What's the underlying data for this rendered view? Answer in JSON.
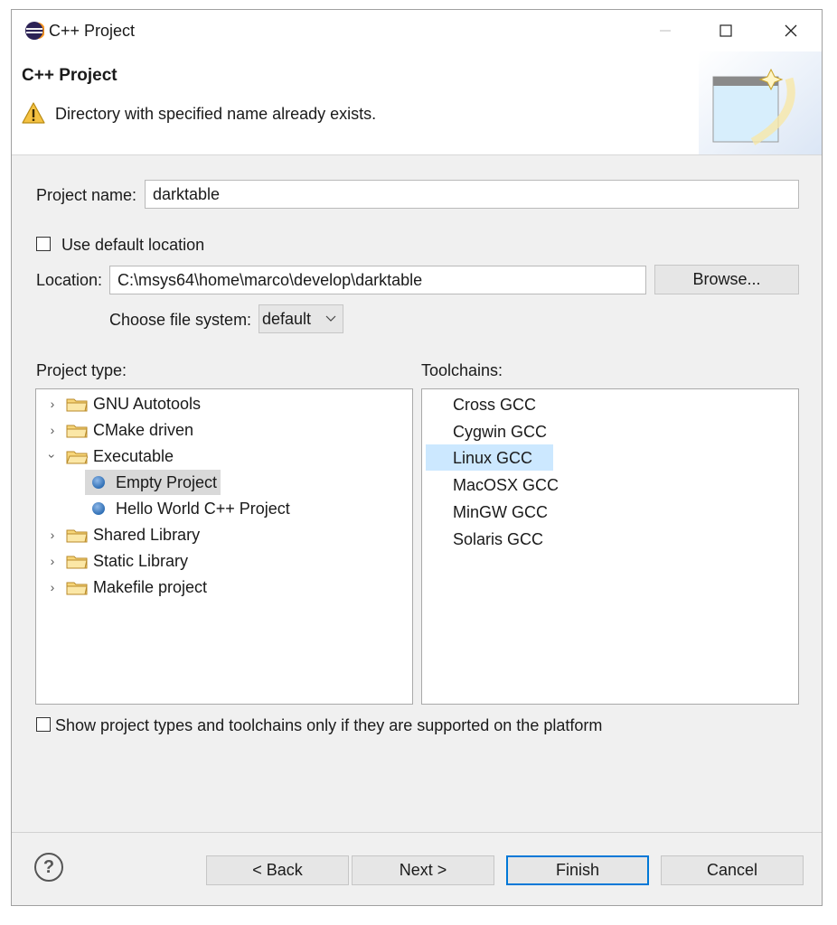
{
  "window": {
    "title": "C++ Project"
  },
  "banner": {
    "title": "C++ Project",
    "message": "Directory with specified name already exists."
  },
  "form": {
    "project_name_label": "Project name:",
    "project_name_value": "darktable",
    "use_default_location_label": "Use default location",
    "location_label": "Location:",
    "location_value": "C:\\msys64\\home\\marco\\develop\\darktable",
    "browse_label": "Browse...",
    "file_system_label": "Choose file system:",
    "file_system_value": "default"
  },
  "project_type": {
    "label": "Project type:",
    "items": [
      {
        "label": "GNU Autotools"
      },
      {
        "label": "CMake driven"
      },
      {
        "label": "Executable"
      },
      {
        "label": "Empty Project"
      },
      {
        "label": "Hello World C++ Project"
      },
      {
        "label": "Shared Library"
      },
      {
        "label": "Static Library"
      },
      {
        "label": "Makefile project"
      }
    ]
  },
  "toolchains": {
    "label": "Toolchains:",
    "items": [
      {
        "label": "Cross GCC"
      },
      {
        "label": "Cygwin GCC"
      },
      {
        "label": "Linux GCC"
      },
      {
        "label": "MacOSX GCC"
      },
      {
        "label": "MinGW GCC"
      },
      {
        "label": "Solaris GCC"
      }
    ]
  },
  "filter_checkbox_label": "Show project types and toolchains only if they are supported on the platform",
  "buttons": {
    "help": "?",
    "back": "< Back",
    "next": "Next >",
    "finish": "Finish",
    "cancel": "Cancel"
  },
  "colors": {
    "selection": "#cce8ff",
    "tree_selection": "#d9d9d9",
    "default_button_border": "#0078d7"
  }
}
